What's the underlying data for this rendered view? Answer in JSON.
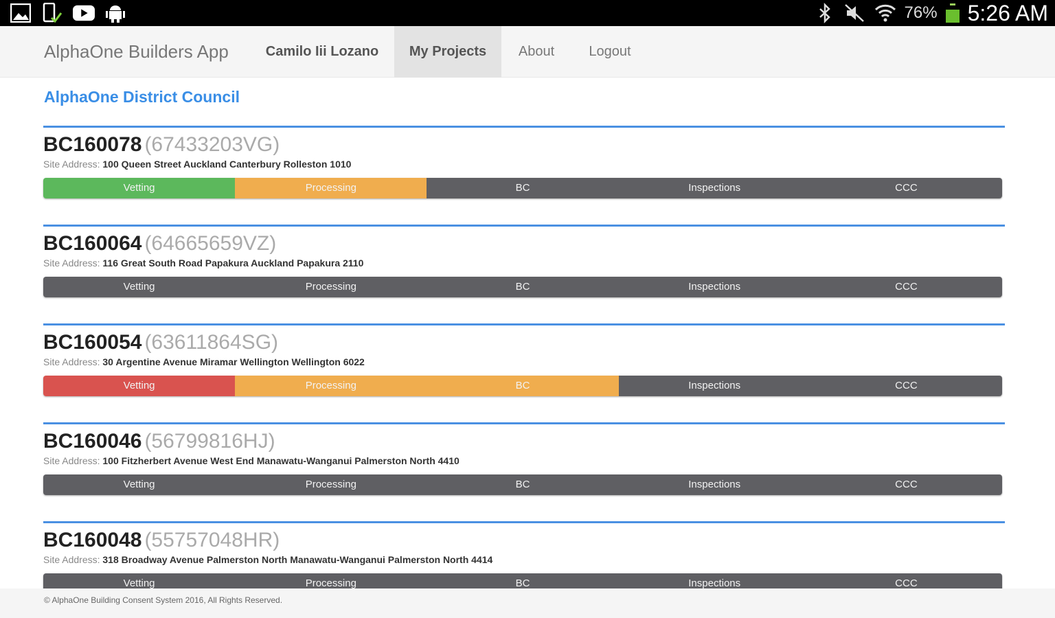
{
  "status_bar": {
    "left_icons": [
      "gallery-icon",
      "phone-check-icon",
      "youtube-icon",
      "android-icon"
    ],
    "right_icons": [
      "bluetooth-icon",
      "mute-icon",
      "wifi-icon"
    ],
    "battery_percent": "76%",
    "battery_level": 0.76,
    "time": "5:26 AM"
  },
  "navbar": {
    "brand": "AlphaOne Builders App",
    "user": "Camilo Iii Lozano",
    "my_projects": "My Projects",
    "about": "About",
    "logout": "Logout"
  },
  "council_title": "AlphaOne District Council",
  "address_label": "Site Address:",
  "stages": [
    "Vetting",
    "Processing",
    "BC",
    "Inspections",
    "CCC"
  ],
  "colors": {
    "accent": "#4a90e2",
    "complete": "#5cb85c",
    "in_progress": "#f0ad4e",
    "failed": "#d9534f",
    "pending": "#5f5f63"
  },
  "projects": [
    {
      "code": "BC160078",
      "ref": "(67433203VG)",
      "address": "100 Queen Street Auckland Canterbury Rolleston 1010",
      "stage_status": [
        "green",
        "orange",
        "gray",
        "gray",
        "gray"
      ]
    },
    {
      "code": "BC160064",
      "ref": "(64665659VZ)",
      "address": "116 Great South Road Papakura Auckland Papakura 2110",
      "stage_status": [
        "gray",
        "gray",
        "gray",
        "gray",
        "gray"
      ]
    },
    {
      "code": "BC160054",
      "ref": "(63611864SG)",
      "address": "30 Argentine Avenue Miramar Wellington Wellington 6022",
      "stage_status": [
        "red",
        "orange",
        "orange",
        "gray",
        "gray"
      ]
    },
    {
      "code": "BC160046",
      "ref": "(56799816HJ)",
      "address": "100 Fitzherbert Avenue West End Manawatu-Wanganui Palmerston North 4410",
      "stage_status": [
        "gray",
        "gray",
        "gray",
        "gray",
        "gray"
      ]
    },
    {
      "code": "BC160048",
      "ref": "(55757048HR)",
      "address": "318 Broadway Avenue Palmerston North Manawatu-Wanganui Palmerston North 4414",
      "stage_status": [
        "gray",
        "gray",
        "gray",
        "gray",
        "gray"
      ]
    }
  ],
  "footer": "© AlphaOne Building Consent System 2016, All Rights Reserved."
}
